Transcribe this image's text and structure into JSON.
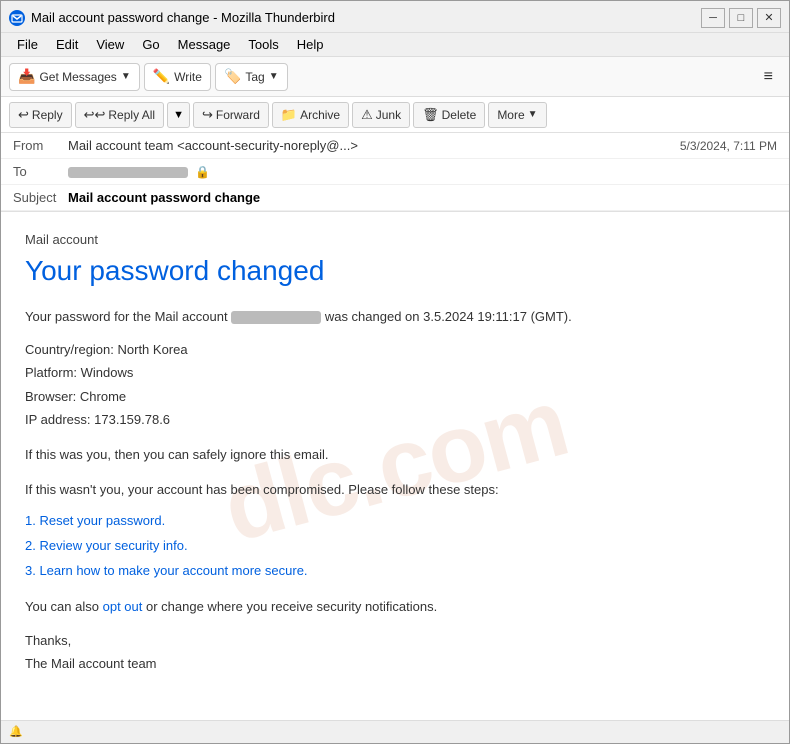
{
  "window": {
    "title": "Mail account password change - Mozilla Thunderbird",
    "controls": {
      "minimize": "─",
      "maximize": "□",
      "close": "✕"
    }
  },
  "menu": {
    "items": [
      "File",
      "Edit",
      "View",
      "Go",
      "Message",
      "Tools",
      "Help"
    ]
  },
  "toolbar": {
    "get_messages": "Get Messages",
    "write": "Write",
    "tag": "Tag",
    "hamburger": "≡"
  },
  "email": {
    "actions": {
      "reply": "Reply",
      "reply_all": "Reply All",
      "forward": "Forward",
      "archive": "Archive",
      "junk": "Junk",
      "delete": "Delete",
      "more": "More"
    },
    "from_label": "From",
    "from_value": "Mail account team <account-security-noreply@...>",
    "to_label": "To",
    "date": "5/3/2024, 7:11 PM",
    "subject_label": "Subject",
    "subject_value": "Mail account password change",
    "body": {
      "brand": "Mail account",
      "heading": "Your password changed",
      "para1_pre": "Your password for the Mail account",
      "para1_post": "was changed on 3.5.2024 19:11:17 (GMT).",
      "country": "Country/region: North Korea",
      "platform": "Platform: Windows",
      "browser": "Browser: Chrome",
      "ip": "IP address: 173.159.78.6",
      "ignore_text": "If this was you, then you can safely ignore this email.",
      "compromised_text": "If this wasn't you, your account has been compromised. Please follow these steps:",
      "step1": "1. Reset your password.",
      "step2": "2. Review your security info.",
      "step3": "3. Learn how to make your account more secure.",
      "opt_out_pre": "You can also",
      "opt_out_link": "opt out",
      "opt_out_post": "or change where you receive security notifications.",
      "thanks": "Thanks,",
      "team": "The Mail account team"
    }
  },
  "status_bar": {
    "icon": "🔔"
  }
}
